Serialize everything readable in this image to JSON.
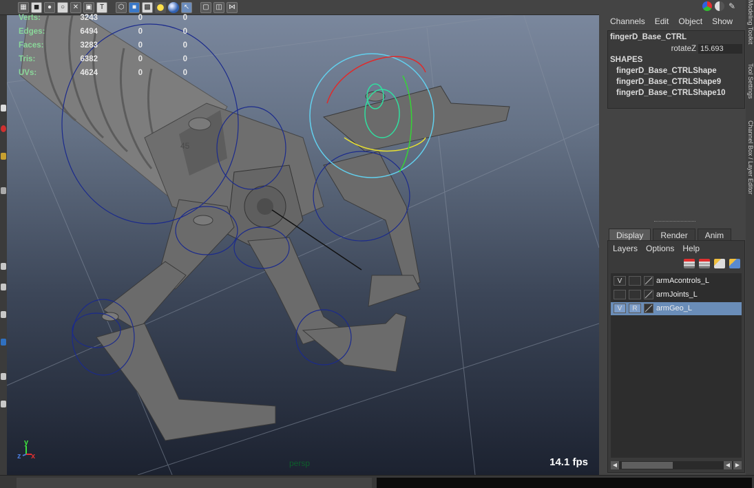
{
  "viewport": {
    "toolbar_icons": [
      "wireframe-on-shaded-icon",
      "texture-icon",
      "lighting-icon",
      "smooth-shade-icon",
      "xray-icon",
      "isolate-icon",
      "text-icon",
      "poly-cube-icon",
      "shaded-cube-icon",
      "checker-icon",
      "light-bulb-icon",
      "sphere-icon",
      "select-cursor-icon",
      "frame-icon",
      "frame-all-icon",
      "share-icon"
    ],
    "stats": {
      "rows": [
        {
          "label": "Verts:",
          "values": [
            "3243",
            "0",
            "0"
          ]
        },
        {
          "label": "Edges:",
          "values": [
            "6494",
            "0",
            "0"
          ]
        },
        {
          "label": "Faces:",
          "values": [
            "3283",
            "0",
            "0"
          ]
        },
        {
          "label": "Tris:",
          "values": [
            "6382",
            "0",
            "0"
          ]
        },
        {
          "label": "UVs:",
          "values": [
            "4624",
            "0",
            "0"
          ]
        }
      ]
    },
    "angle_label": "45",
    "camera_name": "persp",
    "fps": "14.1 fps",
    "axis_labels": {
      "y": "y",
      "z": "z",
      "x": "x"
    },
    "colors": {
      "axis_y": "#3ee03e",
      "axis_x": "#e03030",
      "axis_z": "#4a7ad8"
    }
  },
  "channel_box": {
    "menu": [
      "Channels",
      "Edit",
      "Object",
      "Show"
    ],
    "object_name": "fingerD_Base_CTRL",
    "attribute": {
      "name": "rotateZ",
      "value": "15.693"
    },
    "shapes_header": "SHAPES",
    "shapes": [
      "fingerD_Base_CTRLShape",
      "fingerD_Base_CTRLShape9",
      "fingerD_Base_CTRLShape10"
    ]
  },
  "side_tabs": {
    "top": "Modeling Toolkit",
    "mid": "Tool Settings",
    "bottom": "Channel Box / Layer Editor"
  },
  "layer_editor": {
    "tabs": [
      "Display",
      "Render",
      "Anim"
    ],
    "active_tab": "Display",
    "menu": [
      "Layers",
      "Options",
      "Help"
    ],
    "icons": [
      "new-layer-icon",
      "new-layer-selected-icon",
      "move-layer-up-icon",
      "move-layer-down-icon"
    ],
    "layers": [
      {
        "v": "V",
        "r": "",
        "name": "armAcontrols_L",
        "selected": false
      },
      {
        "v": "",
        "r": "",
        "name": "armJoints_L",
        "selected": false
      },
      {
        "v": "V",
        "r": "R",
        "name": "armGeo_L",
        "selected": true
      }
    ],
    "selection_color": "#6a8db8"
  }
}
